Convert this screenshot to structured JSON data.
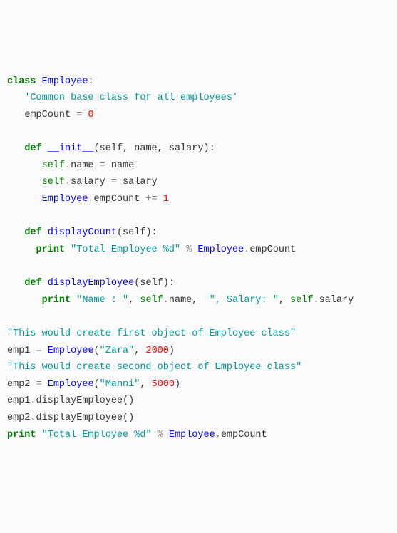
{
  "code": {
    "l1": {
      "kw_class": "class",
      "name": "Employee",
      "colon": ":"
    },
    "l2": {
      "doc": "'Common base class for all employees'"
    },
    "l3": {
      "var": "empCount",
      "eq": "=",
      "val": "0"
    },
    "l5": {
      "kw_def": "def",
      "fn": "__init__",
      "params": "(self, name, salary):"
    },
    "l6": {
      "self": "self",
      "dot": ".",
      "attr": "name",
      "eq": "=",
      "rhs": "name"
    },
    "l7": {
      "self": "self",
      "dot": ".",
      "attr": "salary",
      "eq": "=",
      "rhs": "salary"
    },
    "l8": {
      "cls": "Employee",
      "dot": ".",
      "attr": "empCount",
      "op": "+=",
      "val": "1"
    },
    "l10": {
      "kw_def": "def",
      "fn": "displayCount",
      "params": "(self):"
    },
    "l11": {
      "kw_print": "print",
      "str": "\"Total Employee %d\"",
      "pct": "%",
      "cls": "Employee",
      "dot": ".",
      "attr": "empCount"
    },
    "l13": {
      "kw_def": "def",
      "fn": "displayEmployee",
      "params": "(self):"
    },
    "l14": {
      "kw_print": "print",
      "s1": "\"Name : \"",
      "c1": ",",
      "self1": "self",
      "d1": ".",
      "a1": "name",
      "c2": ",",
      "s2": "\", Salary: \"",
      "c3": ",",
      "self2": "self",
      "d2": ".",
      "a2": "salary"
    },
    "l16": {
      "str": "\"This would create first object of Employee class\""
    },
    "l17": {
      "var": "emp1",
      "eq": "=",
      "cls": "Employee",
      "args_open": "(",
      "s": "\"Zara\"",
      "comma": ",",
      "n": "2000",
      "args_close": ")"
    },
    "l18": {
      "str": "\"This would create second object of Employee class\""
    },
    "l19": {
      "var": "emp2",
      "eq": "=",
      "cls": "Employee",
      "args_open": "(",
      "s": "\"Manni\"",
      "comma": ",",
      "n": "5000",
      "args_close": ")"
    },
    "l20": {
      "obj": "emp1",
      "dot": ".",
      "m": "displayEmployee",
      "call": "()"
    },
    "l21": {
      "obj": "emp2",
      "dot": ".",
      "m": "displayEmployee",
      "call": "()"
    },
    "l22": {
      "kw_print": "print",
      "str": "\"Total Employee %d\"",
      "pct": "%",
      "cls": "Employee",
      "dot": ".",
      "attr": "empCount"
    }
  }
}
